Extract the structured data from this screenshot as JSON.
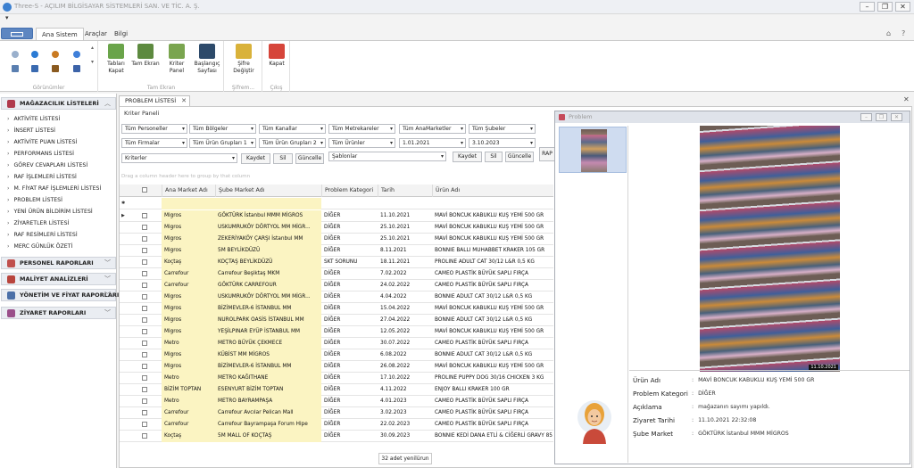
{
  "window": {
    "title": "Three-S - AÇILIM BİLGİSAYAR SİSTEMLERİ SAN. VE TİC. A. Ş.",
    "controls": [
      "–",
      "❐",
      "✕"
    ]
  },
  "ribbon": {
    "tabs": [
      "Ana Sistem",
      "Araçlar",
      "Bilgi"
    ],
    "group_labels": [
      "Görünümler",
      "Tam Ekran",
      "Şifrem...",
      "Çıkış"
    ],
    "buttons": [
      {
        "label": "Tabları Kapat",
        "icon": "tabs-close-icon"
      },
      {
        "label": "Tam Ekran",
        "icon": "fullscreen-icon"
      },
      {
        "label": "Kriter Panel",
        "icon": "criteria-panel-icon"
      },
      {
        "label": "Başlangıç Sayfası",
        "icon": "start-page-icon"
      },
      {
        "label": "Şifre Değiştir",
        "icon": "password-icon"
      },
      {
        "label": "Kapat",
        "icon": "close-icon"
      }
    ]
  },
  "sidebar": {
    "section1": "MAĞAZACILIK LİSTELERİ",
    "items": [
      "AKTİVİTE LİSTESİ",
      "İNSERT LİSTESİ",
      "AKTİVİTE PUAN LİSTESİ",
      "PERFORMANS LİSTESİ",
      "GÖREV CEVAPLARI LİSTESİ",
      "RAF İŞLEMLERİ LİSTESİ",
      "M. FİYAT RAF İŞLEMLERİ LİSTESİ",
      "PROBLEM LİSTESİ",
      "YENİ ÜRÜN BİLDİRİM LİSTESİ",
      "ZİYARETLER LİSTESİ",
      "RAF RESİMLERİ LİSTESİ",
      "MERC GÜNLÜK ÖZETİ"
    ],
    "sections": [
      "PERSONEL RAPORLARI",
      "MALİYET ANALİZLERİ",
      "YÖNETİM VE FİYAT RAPORLARI",
      "ZİYARET RAPORLARI"
    ]
  },
  "document_tab": "PROBLEM LİSTESİ",
  "filters": {
    "panel_title": "Kriter Paneli",
    "row1": [
      "Tüm Personeller",
      "Tüm Bölgeler",
      "Tüm Kanallar",
      "Tüm Metrekareler",
      "Tüm AnaMarketler",
      "Tüm Şubeler"
    ],
    "row2": [
      "Tüm Firmalar",
      "Tüm Ürün Grupları 1",
      "Tüm Ürün Grupları 2",
      "Tüm Ürünler",
      "1.01.2021",
      "3.10.2023"
    ],
    "criteria_placeholder": "Kriterler",
    "templates_placeholder": "Şablonlar",
    "buttons": [
      "Kaydet",
      "Sil",
      "Güncelle"
    ],
    "side_button": "RAP"
  },
  "grid": {
    "group_hint": "Drag a column header here to group by that column",
    "columns": [
      "Ana Market Adı",
      "Şube Market Adı",
      "Problem Kategori",
      "Tarih",
      "Ürün Adı"
    ],
    "rows": [
      [
        "Migros",
        "GÖKTÜRK İstanbul MMM MİGROS",
        "DİĞER",
        "11.10.2021",
        "MAVİ BONCUK KABUKLU KUŞ YEMİ 500 GR"
      ],
      [
        "Migros",
        "USKUMRUKÖY DÖRTYOL MM MİGR...",
        "DİĞER",
        "25.10.2021",
        "MAVİ BONCUK KABUKLU KUŞ YEMİ 500 GR"
      ],
      [
        "Migros",
        "ZEKERİYAKÖY ÇARŞI İstanbul MM",
        "DİĞER",
        "25.10.2021",
        "MAVİ BONCUK KABUKLU KUŞ YEMİ 500 GR"
      ],
      [
        "Migros",
        "5M BEYLİKDÜZÜ",
        "DİĞER",
        "8.11.2021",
        "BONNIE BALLI MUHABBET KRAKER 105 GR"
      ],
      [
        "Koçtaş",
        "KOÇTAŞ BEYLİKDÜZÜ",
        "SKT SORUNU",
        "18.11.2021",
        "PROLINE ADULT CAT 30/12 L&R 0,5 KG"
      ],
      [
        "Carrefour",
        "Carrefour Beşiktaş MKM",
        "DİĞER",
        "7.02.2022",
        "CAMEO PLASTİK BÜYÜK SAPLI FIRÇA"
      ],
      [
        "Carrefour",
        "GÖKTÜRK CARREFOUR",
        "DİĞER",
        "24.02.2022",
        "CAMEO PLASTİK BÜYÜK SAPLI FIRÇA"
      ],
      [
        "Migros",
        "USKUMRUKÖY DÖRTYOL MM MİGR...",
        "DİĞER",
        "4.04.2022",
        "BONNIE ADULT CAT 30/12 L&R 0,5 KG"
      ],
      [
        "Migros",
        "BİZİMEVLER-6 İSTANBUL MM",
        "DİĞER",
        "15.04.2022",
        "MAVİ BONCUK KABUKLU KUŞ YEMİ 500 GR"
      ],
      [
        "Migros",
        "NUROLPARK OASİS İSTANBUL MM",
        "DİĞER",
        "27.04.2022",
        "BONNIE ADULT CAT 30/12 L&R 0,5 KG"
      ],
      [
        "Migros",
        "YEŞİLPINAR EYÜP İSTANBUL MM",
        "DİĞER",
        "12.05.2022",
        "MAVİ BONCUK KABUKLU KUŞ YEMİ 500 GR"
      ],
      [
        "Metro",
        "METRO BÜYÜK ÇEKMECE",
        "DİĞER",
        "30.07.2022",
        "CAMEO PLASTİK BÜYÜK SAPLI FIRÇA"
      ],
      [
        "Migros",
        "KÜBİST MM MİGROS",
        "DİĞER",
        "6.08.2022",
        "BONNIE ADULT CAT 30/12 L&R 0,5 KG"
      ],
      [
        "Migros",
        "BİZİMEVLER-6 İSTANBUL MM",
        "DİĞER",
        "26.08.2022",
        "MAVİ BONCUK KABUKLU KUŞ YEMİ 500 GR"
      ],
      [
        "Metro",
        "METRO KAĞITHANE",
        "DİĞER",
        "17.10.2022",
        "PROLINE PUPPY DOG 30/16 CHICKEN 3 KG"
      ],
      [
        "BİZİM TOPTAN",
        "ESENYURT BİZİM TOPTAN",
        "DİĞER",
        "4.11.2022",
        "ENJOY BALLI KRAKER 100 GR"
      ],
      [
        "Metro",
        "METRO BAYRAMPAŞA",
        "DİĞER",
        "4.01.2023",
        "CAMEO PLASTİK BÜYÜK SAPLI FIRÇA"
      ],
      [
        "Carrefour",
        "Carrefour Avcılar Pelican Mall",
        "DİĞER",
        "3.02.2023",
        "CAMEO PLASTİK BÜYÜK SAPLI FIRÇA"
      ],
      [
        "Carrefour",
        "Carrefour Bayrampaşa Forum Hipe",
        "DİĞER",
        "22.02.2023",
        "CAMEO PLASTİK BÜYÜK SAPLI FIRÇA"
      ],
      [
        "Koçtaş",
        "5M MALL OF KOÇTAŞ",
        "DİĞER",
        "30.09.2023",
        "BONNIE KEDİ DANA ETLİ & CİĞERLİ GRAVY 85"
      ]
    ],
    "footer": "32 adet yenilürun"
  },
  "popup": {
    "title": "Problem",
    "photo_caption": "11.10.2021",
    "labels": [
      "Ürün Adı",
      "Problem Kategori",
      "Açıklama",
      "Ziyaret Tarihi",
      "Şube Market"
    ],
    "values": [
      "MAVİ BONCUK KABUKLU KUŞ YEMİ 500 GR",
      "DİĞER",
      "mağazanın sayımı yapıldı.",
      "11.10.2021 22:32:08",
      "GÖKTÜRK İstanbul MMM MİGROS"
    ]
  },
  "colors": {
    "accent": "#5d86c1",
    "row_highlight": "#fbf4c2",
    "sidebar_icon": "#b03a4c"
  }
}
